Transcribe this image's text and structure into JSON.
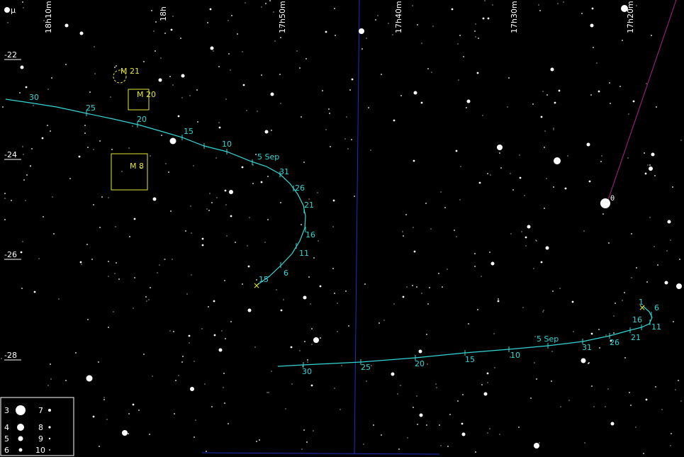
{
  "chart_data": {
    "type": "scatter",
    "title": "",
    "ra_labels": [
      "18h10m",
      "18h",
      "17h50m",
      "17h40m",
      "17h30m",
      "17h20m"
    ],
    "dec_labels": [
      "-22",
      "-24",
      "-26",
      "-28"
    ],
    "dec_extra_label": "μ",
    "objects": [
      {
        "name": "M 21",
        "kind": "open-cluster"
      },
      {
        "name": "M 20",
        "kind": "nebula"
      },
      {
        "name": "M 8",
        "kind": "nebula"
      }
    ],
    "tracks": [
      {
        "start_label": "15",
        "tick_labels": [
          "6",
          "11",
          "16",
          "21",
          "26",
          "31",
          "5 Sep",
          "10",
          "15",
          "20",
          "25",
          "30"
        ]
      },
      {
        "start_label": "1",
        "tick_labels": [
          "6",
          "11",
          "16",
          "21",
          "26",
          "31",
          "5 Sep",
          "10",
          "15",
          "20",
          "25",
          "30"
        ]
      }
    ],
    "star_labels": [
      "θ"
    ],
    "legend": {
      "title": "",
      "magnitudes": [
        "3",
        "4",
        "5",
        "6",
        "7",
        "8",
        "9",
        "10"
      ]
    },
    "colors": {
      "background": "#000000",
      "track": "#33d6d6",
      "objects": "#e6e633",
      "grid": "#1f2fbf",
      "ecliptic": "#b0208f",
      "stars": "#ffffff"
    }
  }
}
